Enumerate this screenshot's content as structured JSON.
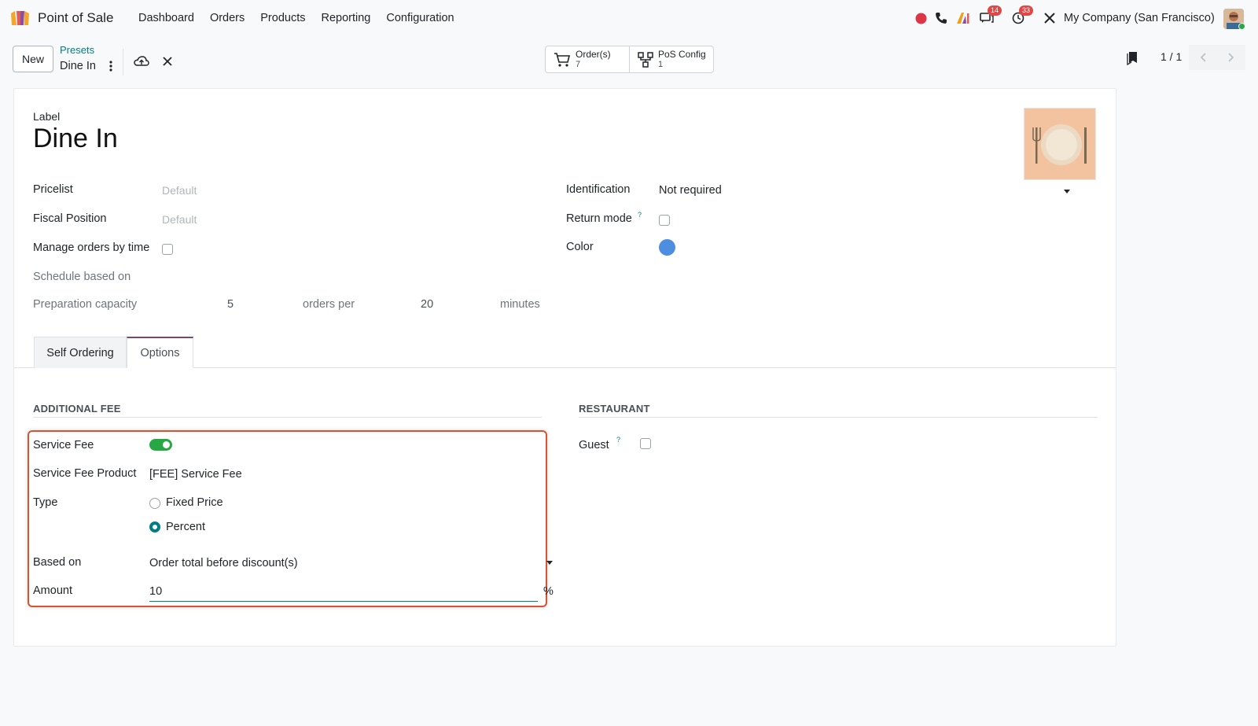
{
  "app": {
    "name": "Point of Sale"
  },
  "menu": [
    "Dashboard",
    "Orders",
    "Products",
    "Reporting",
    "Configuration"
  ],
  "systray": {
    "messages_count": "14",
    "activities_count": "33",
    "company": "My Company (San Francisco)"
  },
  "control_panel": {
    "new_label": "New",
    "breadcrumb_parent": "Presets",
    "breadcrumb_current": "Dine In",
    "smart_buttons": [
      {
        "label": "Order(s)",
        "value": "7",
        "icon": "cart-icon"
      },
      {
        "label": "PoS Config",
        "value": "1",
        "icon": "config-icon"
      }
    ],
    "pager": "1 / 1"
  },
  "form": {
    "label_caption": "Label",
    "title": "Dine In",
    "left_fields": {
      "pricelist": {
        "label": "Pricelist",
        "placeholder": "Default"
      },
      "fiscal_position": {
        "label": "Fiscal Position",
        "placeholder": "Default"
      },
      "manage_orders_by_time": {
        "label": "Manage orders by time",
        "checked": false
      },
      "schedule_based_on": {
        "label": "Schedule based on"
      },
      "preparation_capacity": {
        "label": "Preparation capacity",
        "orders": "5",
        "orders_per_label": "orders per",
        "minutes_value": "20",
        "minutes_label": "minutes"
      }
    },
    "right_fields": {
      "identification": {
        "label": "Identification",
        "value": "Not required"
      },
      "return_mode": {
        "label": "Return mode",
        "help": "?",
        "checked": false
      },
      "color": {
        "label": "Color",
        "value": "#4e8ee0"
      }
    },
    "tabs": [
      {
        "label": "Self Ordering",
        "active": false
      },
      {
        "label": "Options",
        "active": true
      }
    ],
    "additional_fee": {
      "title": "ADDITIONAL FEE",
      "service_fee": {
        "label": "Service Fee",
        "enabled": true
      },
      "service_fee_product": {
        "label": "Service Fee Product",
        "value": "[FEE] Service Fee"
      },
      "type": {
        "label": "Type",
        "options": [
          "Fixed Price",
          "Percent"
        ],
        "selected": "Percent"
      },
      "based_on": {
        "label": "Based on",
        "value": "Order total before discount(s)"
      },
      "amount": {
        "label": "Amount",
        "value": "10",
        "unit": "%"
      }
    },
    "restaurant": {
      "title": "RESTAURANT",
      "guest": {
        "label": "Guest",
        "help": "?",
        "checked": false
      }
    }
  },
  "colors": {
    "accent": "#017e84",
    "brand": "#714b67",
    "highlight": "#d9532f",
    "toggle_on": "#28a745"
  }
}
